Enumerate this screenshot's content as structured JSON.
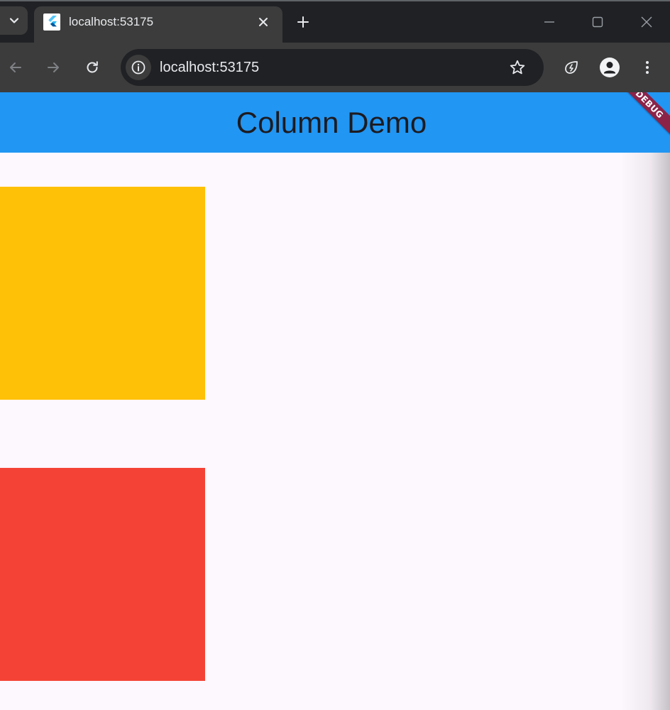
{
  "browser": {
    "tab": {
      "title": "localhost:53175",
      "favicon": "flutter-icon"
    },
    "address": {
      "url": "localhost:53175"
    },
    "icons": {
      "tab_search": "chevron-down-icon",
      "tab_close": "close-icon",
      "new_tab": "plus-icon",
      "back": "arrow-left-icon",
      "forward": "arrow-right-icon",
      "reload": "reload-icon",
      "site_info": "info-icon",
      "bookmark": "star-icon",
      "extension": "leaf-icon",
      "profile": "person-icon",
      "menu": "more-vert-icon"
    }
  },
  "app": {
    "title": "Column Demo",
    "debug_banner": "DEBUG",
    "boxes": [
      {
        "color": "#ffc107"
      },
      {
        "color": "#f44336"
      }
    ],
    "colors": {
      "appbar": "#2196f3",
      "background": "#fdf7fe",
      "banner": "#8b2349"
    }
  }
}
